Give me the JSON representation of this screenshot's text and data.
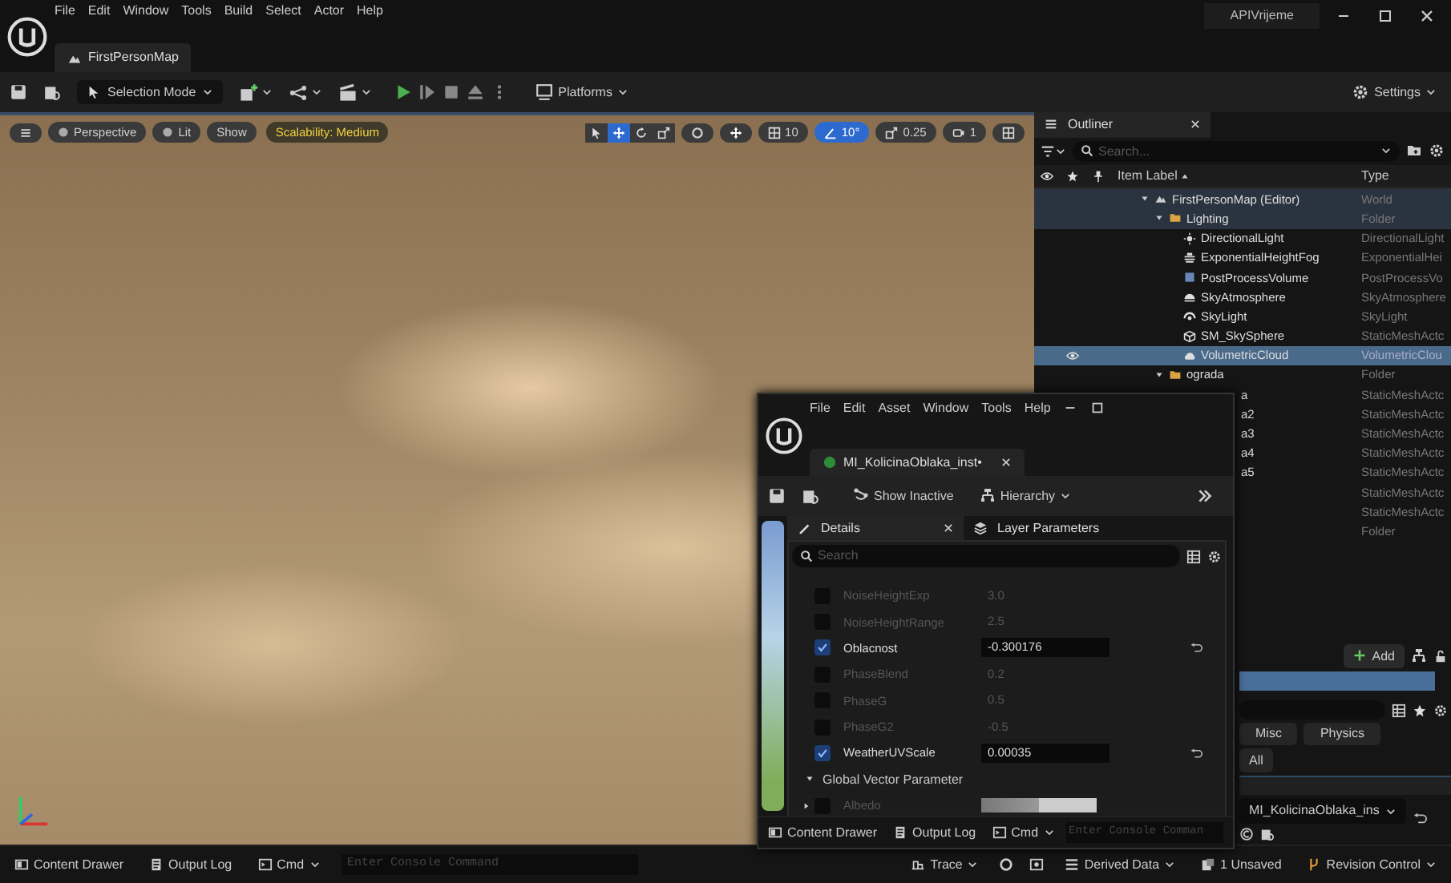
{
  "app_menu": [
    "File",
    "Edit",
    "Window",
    "Tools",
    "Build",
    "Select",
    "Actor",
    "Help"
  ],
  "document_tab": {
    "label": "FirstPersonMap",
    "selected": true
  },
  "project_name": "APIVrijeme",
  "toolbar": {
    "mode": "Selection Mode",
    "platforms": "Platforms",
    "settings": "Settings"
  },
  "viewport": {
    "buttons": [
      "Perspective",
      "Lit",
      "Show"
    ],
    "scalability": "Scalability: Medium",
    "transform_tools": [
      {
        "selected": false
      },
      {
        "selected": true
      },
      {
        "selected": false
      },
      {
        "selected": false
      }
    ],
    "snaps": [
      {
        "label": "10",
        "on": false
      },
      {
        "label": "10°",
        "on": true
      },
      {
        "label": "0.25",
        "on": false
      },
      {
        "label": "1",
        "on": false
      }
    ]
  },
  "outliner": {
    "title": "Outliner",
    "search_placeholder": "Search...",
    "columns": [
      "Item Label",
      "Type"
    ],
    "rows": [
      {
        "label": "FirstPersonMap (Editor)",
        "type": "World",
        "kind": "world",
        "selected": false,
        "children": [
          {
            "label": "Lighting",
            "type": "Folder",
            "kind": "folder",
            "selected": false,
            "children": [
              {
                "label": "DirectionalLight",
                "type": "DirectionalLight",
                "kind": "light",
                "selected": false
              },
              {
                "label": "ExponentialHeightFog",
                "type": "ExponentialHei",
                "kind": "fog",
                "selected": false
              },
              {
                "label": "PostProcessVolume",
                "type": "PostProcessVo",
                "kind": "volume",
                "selected": false
              },
              {
                "label": "SkyAtmosphere",
                "type": "SkyAtmosphere",
                "kind": "atmosphere",
                "selected": false
              },
              {
                "label": "SkyLight",
                "type": "SkyLight",
                "kind": "skylight",
                "selected": false
              },
              {
                "label": "SM_SkySphere",
                "type": "StaticMeshActc",
                "kind": "mesh",
                "selected": false
              },
              {
                "label": "VolumetricCloud",
                "type": "VolumetricClou",
                "kind": "cloud",
                "selected": true
              }
            ]
          },
          {
            "label": "ograda",
            "type": "Folder",
            "kind": "folder",
            "selected": false,
            "children": [
              {
                "label": "a",
                "type": "StaticMeshActc",
                "kind": "occluded",
                "selected": false
              },
              {
                "label": "a2",
                "type": "StaticMeshActc",
                "kind": "occluded",
                "selected": false
              },
              {
                "label": "a3",
                "type": "StaticMeshActc",
                "kind": "occluded",
                "selected": false
              },
              {
                "label": "a4",
                "type": "StaticMeshActc",
                "kind": "occluded",
                "selected": false
              },
              {
                "label": "a5",
                "type": "StaticMeshActc",
                "kind": "occluded",
                "selected": false
              },
              {
                "type": "StaticMeshActc",
                "kind": "occluded",
                "selected": false
              },
              {
                "type": "StaticMeshActc",
                "kind": "occluded",
                "selected": false
              }
            ]
          },
          {
            "type": "Folder",
            "kind": "occluded",
            "selected": false
          }
        ]
      }
    ]
  },
  "details": {
    "add": "Add",
    "tabs": [
      {
        "label": "Misc"
      },
      {
        "label": "Physics"
      }
    ],
    "all": "All",
    "material_slot": "MI_KolicinaOblaka_ins"
  },
  "material_editor": {
    "menu": [
      "File",
      "Edit",
      "Asset",
      "Window",
      "Tools",
      "Help"
    ],
    "tab": "MI_KolicinaOblaka_inst•",
    "toolbar": [
      "Show Inactive",
      "Hierarchy"
    ],
    "panel_tabs": [
      {
        "label": "Details",
        "selected": true
      },
      {
        "label": "Layer Parameters",
        "selected": false
      }
    ],
    "search_placeholder": "Search",
    "parameters": [
      {
        "name": "NoiseHeightExp",
        "value": "3.0",
        "checked": false
      },
      {
        "name": "NoiseHeightRange",
        "value": "2.5",
        "checked": false
      },
      {
        "name": "Oblacnost",
        "value": "-0.300176",
        "checked": true
      },
      {
        "name": "PhaseBlend",
        "value": "0.2",
        "checked": false
      },
      {
        "name": "PhaseG",
        "value": "0.5",
        "checked": false
      },
      {
        "name": "PhaseG2",
        "value": "-0.5",
        "checked": false
      },
      {
        "name": "WeatherUVScale",
        "value": "0.00035",
        "checked": true
      }
    ],
    "section": "Global Vector Parameter",
    "vector_param": {
      "name": "Albedo",
      "checked": false
    },
    "bottom_bar": {
      "content_drawer": "Content Drawer",
      "output_log": "Output Log",
      "cmd": "Cmd",
      "console_placeholder": "Enter Console Comman"
    }
  },
  "status_bar": {
    "content_drawer": "Content Drawer",
    "output_log": "Output Log",
    "cmd": "Cmd",
    "console_placeholder": "Enter Console Command",
    "trace": "Trace",
    "derived_data": "Derived Data",
    "unsaved": "1 Unsaved",
    "revision_control": "Revision Control"
  }
}
